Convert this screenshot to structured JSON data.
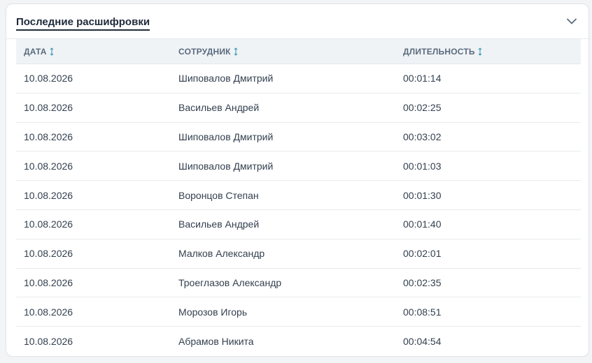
{
  "card": {
    "title": "Последние расшифровки"
  },
  "icons": {
    "collapse": "chevron-down-icon",
    "sort": "sort-arrows-icon"
  },
  "colors": {
    "accent": "#1f2a3a",
    "header_bg": "#f0f3f6",
    "sort_icon": "#3a9ab0"
  },
  "table": {
    "columns": {
      "date": "ДАТА",
      "employee": "СОТРУДНИК",
      "duration": "ДЛИТЕЛЬНОСТЬ"
    },
    "rows": [
      {
        "date": "10.08.2026",
        "employee": "Шиповалов Дмитрий",
        "duration": "00:01:14"
      },
      {
        "date": "10.08.2026",
        "employee": "Васильев Андрей",
        "duration": "00:02:25"
      },
      {
        "date": "10.08.2026",
        "employee": "Шиповалов Дмитрий",
        "duration": "00:03:02"
      },
      {
        "date": "10.08.2026",
        "employee": "Шиповалов Дмитрий",
        "duration": "00:01:03"
      },
      {
        "date": "10.08.2026",
        "employee": "Воронцов Степан",
        "duration": "00:01:30"
      },
      {
        "date": "10.08.2026",
        "employee": "Васильев Андрей",
        "duration": "00:01:40"
      },
      {
        "date": "10.08.2026",
        "employee": "Малков Александр",
        "duration": "00:02:01"
      },
      {
        "date": "10.08.2026",
        "employee": "Троеглазов Александр",
        "duration": "00:02:35"
      },
      {
        "date": "10.08.2026",
        "employee": "Морозов Игорь",
        "duration": "00:08:51"
      },
      {
        "date": "10.08.2026",
        "employee": "Абрамов Никита",
        "duration": "00:04:54"
      }
    ]
  }
}
